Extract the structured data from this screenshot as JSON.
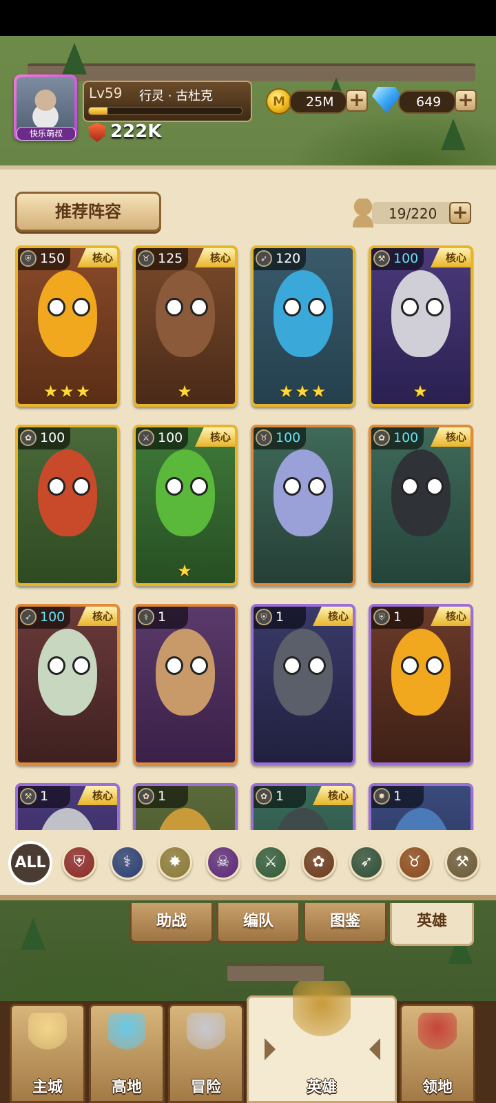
{
  "player": {
    "nickname": "快乐萌叔",
    "level_label": "Lv59",
    "hero_title": "行灵 · 古杜克",
    "xp_fraction": 0.12,
    "power": "222K"
  },
  "resources": {
    "gold": "25M",
    "gems": "649"
  },
  "panel": {
    "recommend_label": "推荐阵容",
    "capacity": "19/220"
  },
  "heroes": [
    {
      "level": "150",
      "core": true,
      "stars": "★★★",
      "level_color": "white",
      "frame": "gold",
      "class_icon": "shield"
    },
    {
      "level": "125",
      "core": true,
      "stars": "★",
      "level_color": "white",
      "frame": "gold",
      "class_icon": "horns"
    },
    {
      "level": "120",
      "core": false,
      "stars": "★★★",
      "level_color": "white",
      "frame": "gold",
      "class_icon": "bow"
    },
    {
      "level": "100",
      "core": true,
      "stars": "★",
      "level_color": "cyan",
      "frame": "gold",
      "class_icon": "axe"
    },
    {
      "level": "100",
      "core": false,
      "stars": "",
      "level_color": "white",
      "frame": "gold",
      "class_icon": "paw"
    },
    {
      "level": "100",
      "core": true,
      "stars": "★",
      "level_color": "white",
      "frame": "gold",
      "class_icon": "swords"
    },
    {
      "level": "100",
      "core": false,
      "stars": "",
      "level_color": "cyan",
      "frame": "orange",
      "class_icon": "horns"
    },
    {
      "level": "100",
      "core": true,
      "stars": "",
      "level_color": "cyan",
      "frame": "orange",
      "class_icon": "paw"
    },
    {
      "level": "100",
      "core": true,
      "stars": "",
      "level_color": "cyan",
      "frame": "orange",
      "class_icon": "bow"
    },
    {
      "level": "1",
      "core": false,
      "stars": "",
      "level_color": "white",
      "frame": "orange",
      "class_icon": "staff"
    },
    {
      "level": "1",
      "core": true,
      "stars": "",
      "level_color": "white",
      "frame": "purple",
      "class_icon": "shield"
    },
    {
      "level": "1",
      "core": true,
      "stars": "",
      "level_color": "white",
      "frame": "purple",
      "class_icon": "shield"
    },
    {
      "level": "1",
      "core": true,
      "stars": "",
      "level_color": "white",
      "frame": "purple",
      "class_icon": "axe"
    },
    {
      "level": "1",
      "core": false,
      "stars": "",
      "level_color": "white",
      "frame": "purple",
      "class_icon": "paw"
    },
    {
      "level": "1",
      "core": true,
      "stars": "",
      "level_color": "white",
      "frame": "purple",
      "class_icon": "paw"
    },
    {
      "level": "1",
      "core": false,
      "stars": "",
      "level_color": "white",
      "frame": "purple",
      "class_icon": "burst"
    }
  ],
  "core_label": "核心",
  "filters": {
    "all_label": "ALL",
    "items": [
      {
        "icon": "shield-icon",
        "glyph": "⛨",
        "color": "#8a2a2a"
      },
      {
        "icon": "staff-icon",
        "glyph": "⚕",
        "color": "#2b3f74"
      },
      {
        "icon": "burst-icon",
        "glyph": "✸",
        "color": "#8a7a3a"
      },
      {
        "icon": "skull-icon",
        "glyph": "☠",
        "color": "#5a2a7a"
      },
      {
        "icon": "crossed-swords-icon",
        "glyph": "⚔",
        "color": "#2f5a3a"
      },
      {
        "icon": "paw-icon",
        "glyph": "✿",
        "color": "#6b3a1f"
      },
      {
        "icon": "bow-icon",
        "glyph": "➶",
        "color": "#2f4f3a"
      },
      {
        "icon": "horns-icon",
        "glyph": "♉",
        "color": "#8a4a1f"
      },
      {
        "icon": "axe-icon",
        "glyph": "⚒",
        "color": "#6b5a3a"
      }
    ]
  },
  "sub_tabs": [
    "助战",
    "编队",
    "图鉴",
    "英雄"
  ],
  "sub_tab_active": "英雄",
  "nav": [
    {
      "label": "主城",
      "icon": "castle-icon"
    },
    {
      "label": "高地",
      "icon": "highland-icon"
    },
    {
      "label": "冒险",
      "icon": "crossed-swords-icon"
    },
    {
      "label": "英雄",
      "icon": "helmet-icon"
    },
    {
      "label": "领地",
      "icon": "banner-icon"
    }
  ],
  "nav_active": "英雄"
}
